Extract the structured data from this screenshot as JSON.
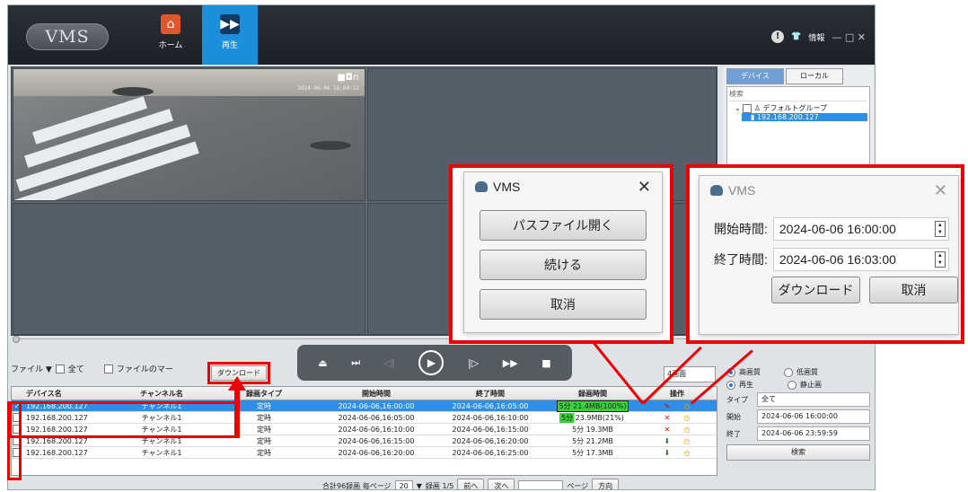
{
  "app": {
    "logo": "VMS",
    "nav": [
      {
        "label": "ホーム",
        "icon": "home-icon"
      },
      {
        "label": "再生",
        "icon": "playback-icon"
      }
    ],
    "info_label": "情報",
    "window_controls": "— □ ✕"
  },
  "video": {
    "timestamp": "2024-06-06 16:00:12"
  },
  "controls": {
    "file_label": "ファイル ▼",
    "all_label": "全て",
    "file_only_label": "ファイルのマー",
    "download_label": "ダウンロード",
    "split_label": "4画面"
  },
  "table": {
    "headers": [
      "デバイス名",
      "チャンネル名",
      "録画タイプ",
      "開始時間",
      "終了時間",
      "録画時間",
      "操作"
    ],
    "rows": [
      {
        "device": "192.168.200.127",
        "channel": "チャンネル1",
        "type": "定時",
        "start": "2024-06-06,16:00:00",
        "end": "2024-06-06,16:05:00",
        "rec": "5分 21.4MB(100%)",
        "checked": true
      },
      {
        "device": "192.168.200.127",
        "channel": "チャンネル1",
        "type": "定時",
        "start": "2024-06-06,16:05:00",
        "end": "2024-06-06,16:10:00",
        "rec": "5分 23.9MB(21%)",
        "checked": false
      },
      {
        "device": "192.168.200.127",
        "channel": "チャンネル1",
        "type": "定時",
        "start": "2024-06-06,16:10:00",
        "end": "2024-06-06,16:15:00",
        "rec": "5分 19.3MB",
        "checked": false
      },
      {
        "device": "192.168.200.127",
        "channel": "チャンネル1",
        "type": "定時",
        "start": "2024-06-06,16:15:00",
        "end": "2024-06-06,16:20:00",
        "rec": "5分 21.2MB",
        "checked": false
      },
      {
        "device": "192.168.200.127",
        "channel": "チャンネル1",
        "type": "定時",
        "start": "2024-06-06,16:20:00",
        "end": "2024-06-06,16:25:00",
        "rec": "5分 17.3MB",
        "checked": false
      }
    ]
  },
  "footer": {
    "total": "合計96録画 毎ページ",
    "per_page": "20",
    "page_info": "録画 1/5",
    "prev": "前へ",
    "next": "次へ",
    "page_label": "ページ",
    "go": "方向"
  },
  "right": {
    "tabs": [
      "デバイス",
      "ローカル"
    ],
    "search_placeholder": "検索",
    "group": "デフォルトグループ",
    "device": "192.168.200.127",
    "quality_high": "高画質",
    "quality_low": "低画質",
    "mode_play": "再生",
    "mode_still": "静止画",
    "type_label": "タイプ",
    "type_value": "全て",
    "start_label": "開始",
    "start_value": "2024-06-06 16:00:00",
    "end_label": "終了",
    "end_value": "2024-06-06 23:59:59",
    "search_btn": "検索"
  },
  "dialog1": {
    "title": "VMS",
    "btn_open_path": "パスファイル開く",
    "btn_continue": "続ける",
    "btn_cancel": "取消"
  },
  "dialog2": {
    "title": "VMS",
    "start_label": "開始時間:",
    "start_value": "2024-06-06 16:00:00",
    "end_label": "終了時間:",
    "end_value": "2024-06-06 16:03:00",
    "btn_download": "ダウンロード",
    "btn_cancel": "取消"
  },
  "colors": {
    "accent": "#1c8fdc",
    "annotation": "#e00000",
    "progress": "#3ad13a"
  }
}
